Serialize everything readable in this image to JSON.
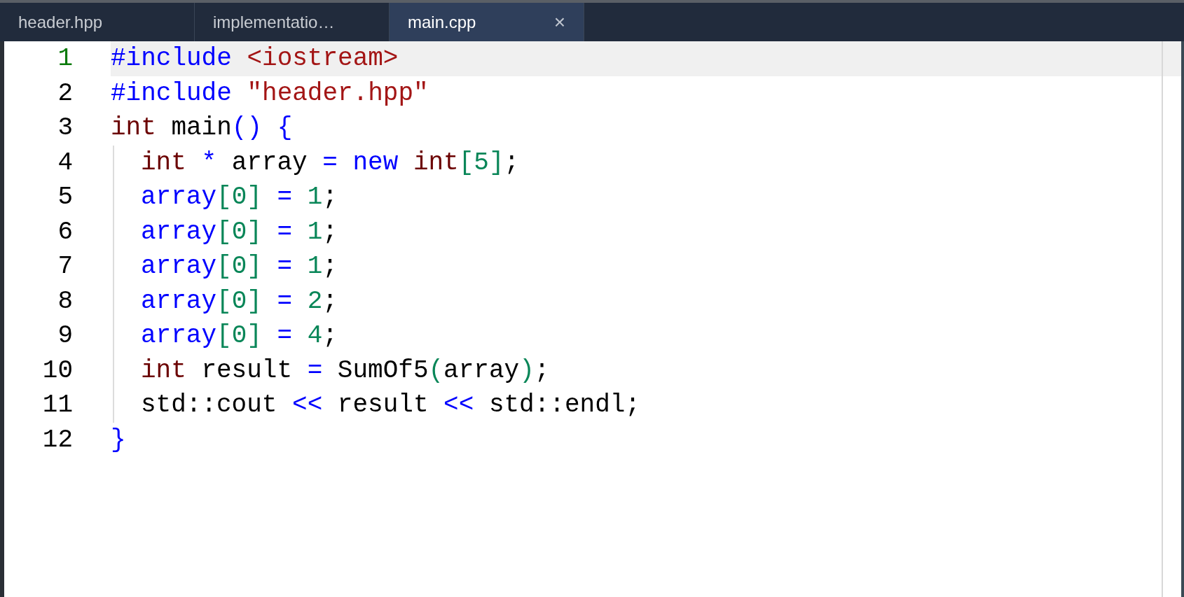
{
  "tabs": [
    {
      "label": "header.hpp",
      "selected": false
    },
    {
      "label": "implementatio…",
      "selected": false
    },
    {
      "label": "main.cpp",
      "selected": true,
      "close": "×"
    }
  ],
  "lines": [
    {
      "number": "1",
      "current": true,
      "tokens": [
        {
          "text": "#include ",
          "kind": "keyword"
        },
        {
          "text": "<iostream>",
          "kind": "string"
        }
      ]
    },
    {
      "number": "2",
      "current": false,
      "tokens": [
        {
          "text": "#include ",
          "kind": "keyword"
        },
        {
          "text": "\"header.hpp\"",
          "kind": "string"
        }
      ]
    },
    {
      "number": "3",
      "current": false,
      "tokens": [
        {
          "text": "int",
          "kind": "type"
        },
        {
          "text": " main",
          "kind": "plain"
        },
        {
          "text": "() {",
          "kind": "keyword"
        }
      ],
      "children": [
        {
          "number": "4",
          "current": false,
          "tokens": [
            {
              "text": "int",
              "kind": "type"
            },
            {
              "text": " * ",
              "kind": "keyword"
            },
            {
              "text": "array ",
              "kind": "plain"
            },
            {
              "text": "= new ",
              "kind": "keyword"
            },
            {
              "text": "int",
              "kind": "type"
            },
            {
              "text": "[5]",
              "kind": "number"
            },
            {
              "text": ";",
              "kind": "plain"
            }
          ]
        },
        {
          "number": "5",
          "current": false,
          "tokens": [
            {
              "text": "array",
              "kind": "keyword"
            },
            {
              "text": "[0] ",
              "kind": "number"
            },
            {
              "text": "= ",
              "kind": "keyword"
            },
            {
              "text": "1",
              "kind": "number"
            },
            {
              "text": ";",
              "kind": "plain"
            }
          ]
        },
        {
          "number": "6",
          "current": false,
          "tokens": [
            {
              "text": "array",
              "kind": "keyword"
            },
            {
              "text": "[0] ",
              "kind": "number"
            },
            {
              "text": "= ",
              "kind": "keyword"
            },
            {
              "text": "1",
              "kind": "number"
            },
            {
              "text": ";",
              "kind": "plain"
            }
          ]
        },
        {
          "number": "7",
          "current": false,
          "tokens": [
            {
              "text": "array",
              "kind": "keyword"
            },
            {
              "text": "[0] ",
              "kind": "number"
            },
            {
              "text": "= ",
              "kind": "keyword"
            },
            {
              "text": "1",
              "kind": "number"
            },
            {
              "text": ";",
              "kind": "plain"
            }
          ]
        },
        {
          "number": "8",
          "current": false,
          "tokens": [
            {
              "text": "array",
              "kind": "keyword"
            },
            {
              "text": "[0] ",
              "kind": "number"
            },
            {
              "text": "= ",
              "kind": "keyword"
            },
            {
              "text": "2",
              "kind": "number"
            },
            {
              "text": ";",
              "kind": "plain"
            }
          ]
        },
        {
          "number": "9",
          "current": false,
          "tokens": [
            {
              "text": "array",
              "kind": "keyword"
            },
            {
              "text": "[0] ",
              "kind": "number"
            },
            {
              "text": "= ",
              "kind": "keyword"
            },
            {
              "text": "4",
              "kind": "number"
            },
            {
              "text": ";",
              "kind": "plain"
            }
          ]
        },
        {
          "number": "10",
          "current": false,
          "tokens": [
            {
              "text": "int",
              "kind": "type"
            },
            {
              "text": " result ",
              "kind": "plain"
            },
            {
              "text": "= ",
              "kind": "keyword"
            },
            {
              "text": "SumOf5",
              "kind": "plain"
            },
            {
              "text": "(",
              "kind": "number"
            },
            {
              "text": "array",
              "kind": "plain"
            },
            {
              "text": ")",
              "kind": "number"
            },
            {
              "text": ";",
              "kind": "plain"
            }
          ]
        },
        {
          "number": "11",
          "current": false,
          "tokens": [
            {
              "text": "std::cout ",
              "kind": "plain"
            },
            {
              "text": "<< ",
              "kind": "keyword"
            },
            {
              "text": "result ",
              "kind": "plain"
            },
            {
              "text": "<< ",
              "kind": "keyword"
            },
            {
              "text": "std::endl;",
              "kind": "plain"
            }
          ]
        }
      ]
    },
    {
      "number": "12",
      "current": false,
      "tokens": [
        {
          "text": "}",
          "kind": "keyword"
        }
      ]
    }
  ]
}
